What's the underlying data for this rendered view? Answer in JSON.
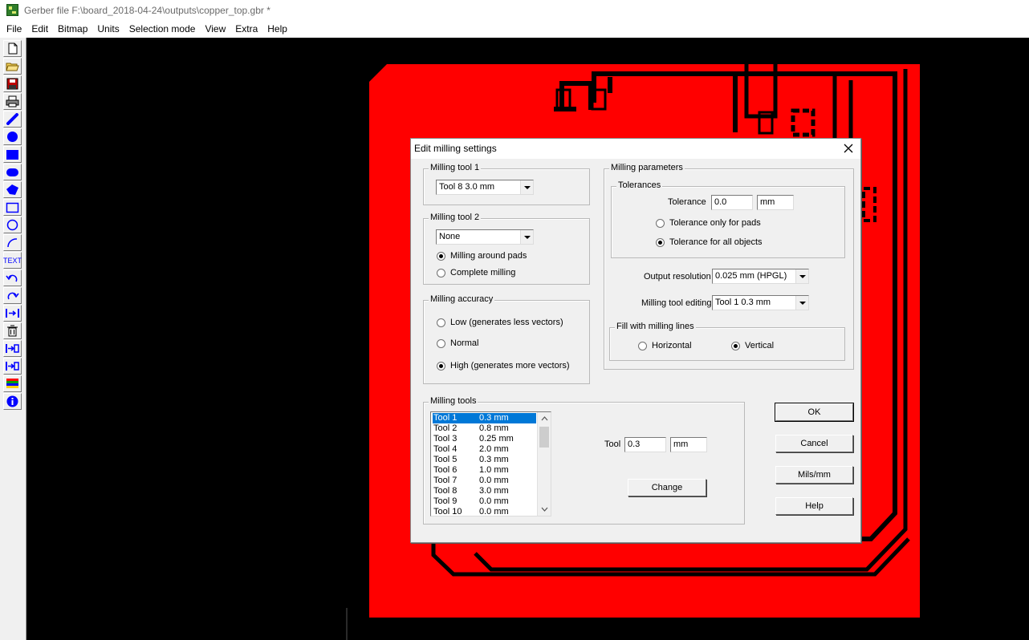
{
  "window": {
    "title": "Gerber file F:\\board_2018-04-24\\outputs\\copper_top.gbr *"
  },
  "menu": [
    "File",
    "Edit",
    "Bitmap",
    "Units",
    "Selection mode",
    "View",
    "Extra",
    "Help"
  ],
  "toolbar": {
    "icons": [
      "new-file-icon",
      "open-folder-icon",
      "save-disk-icon",
      "print-icon",
      "line-draw-icon",
      "circle-fill-icon",
      "rectangle-fill-icon",
      "rounded-pad-icon",
      "polygon-icon",
      "rectangle-outline-icon",
      "circle-outline-icon",
      "arc-icon",
      "text-icon",
      "undo-icon",
      "redo-icon",
      "mirror-icon",
      "delete-icon",
      "align-icon",
      "distribute-icon",
      "layers-icon",
      "info-icon"
    ],
    "text_tool_label": "TEXT"
  },
  "dialog": {
    "title": "Edit milling settings",
    "milling_tool_1": {
      "legend": "Milling tool 1",
      "value": "Tool 8   3.0 mm"
    },
    "milling_tool_2": {
      "legend": "Milling tool 2",
      "value": "None",
      "options": [
        {
          "label": "Milling around pads",
          "checked": true
        },
        {
          "label": "Complete milling",
          "checked": false
        }
      ]
    },
    "milling_accuracy": {
      "legend": "Milling accuracy",
      "options": [
        {
          "label": "Low (generates less vectors)",
          "checked": false
        },
        {
          "label": "Normal",
          "checked": false
        },
        {
          "label": "High (generates more vectors)",
          "checked": true
        }
      ]
    },
    "milling_parameters": {
      "legend": "Milling parameters",
      "tolerances": {
        "legend": "Tolerances",
        "tolerance_label": "Tolerance",
        "tolerance_value": "0.0",
        "tolerance_unit": "mm",
        "options": [
          {
            "label": "Tolerance only for pads",
            "checked": false
          },
          {
            "label": "Tolerance for all objects",
            "checked": true
          }
        ]
      },
      "output_resolution_label": "Output resolution",
      "output_resolution_value": "0.025 mm (HPGL)",
      "tool_editing_label": "Milling tool editing",
      "tool_editing_value": "Tool 1   0.3 mm",
      "fill": {
        "legend": "Fill with milling lines",
        "options": [
          {
            "label": "Horizontal",
            "checked": false
          },
          {
            "label": "Vertical",
            "checked": true
          }
        ]
      }
    },
    "milling_tools": {
      "legend": "Milling tools",
      "items": [
        {
          "name": "Tool 1",
          "size": "0.3 mm",
          "selected": true
        },
        {
          "name": "Tool 2",
          "size": "0.8 mm"
        },
        {
          "name": "Tool 3",
          "size": "0.25 mm"
        },
        {
          "name": "Tool 4",
          "size": "2.0 mm"
        },
        {
          "name": "Tool 5",
          "size": "0.3 mm"
        },
        {
          "name": "Tool 6",
          "size": "1.0 mm"
        },
        {
          "name": "Tool 7",
          "size": "0.0 mm"
        },
        {
          "name": "Tool 8",
          "size": "3.0 mm"
        },
        {
          "name": "Tool 9",
          "size": "0.0 mm"
        },
        {
          "name": "Tool 10",
          "size": "0.0 mm"
        }
      ],
      "tool_label": "Tool",
      "tool_value": "0.3",
      "tool_unit": "mm",
      "change_label": "Change"
    },
    "buttons": {
      "ok": "OK",
      "cancel": "Cancel",
      "mils_mm": "Mils/mm",
      "help": "Help"
    }
  },
  "colors": {
    "copper": "#ff0000",
    "background": "#000000",
    "selection": "#0078d7"
  }
}
